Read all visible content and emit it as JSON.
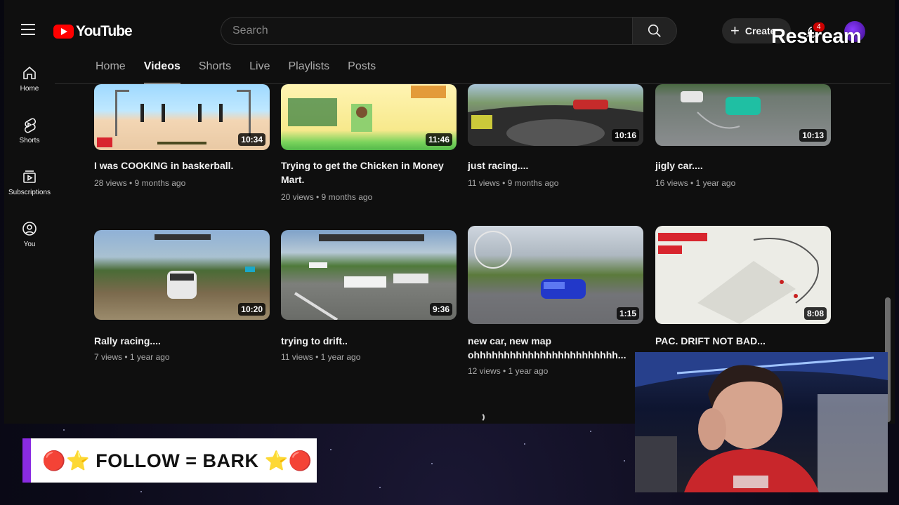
{
  "header": {
    "logo_text": "YouTube",
    "search_placeholder": "Search",
    "create_label": "Create",
    "notification_count": "4"
  },
  "overlay": {
    "restream_label": "Restream",
    "follow_text": "🔴⭐ FOLLOW = BARK ⭐🔴"
  },
  "sidebar": {
    "items": [
      {
        "label": "Home",
        "icon": "home-icon"
      },
      {
        "label": "Shorts",
        "icon": "shorts-icon"
      },
      {
        "label": "Subscriptions",
        "icon": "subscriptions-icon"
      },
      {
        "label": "You",
        "icon": "you-icon"
      }
    ]
  },
  "tabs": [
    {
      "label": "Home",
      "active": false
    },
    {
      "label": "Videos",
      "active": true
    },
    {
      "label": "Shorts",
      "active": false
    },
    {
      "label": "Live",
      "active": false
    },
    {
      "label": "Playlists",
      "active": false
    },
    {
      "label": "Posts",
      "active": false
    }
  ],
  "videos": [
    {
      "title": "I was COOKING in baskerball.",
      "meta": "28 views • 9 months ago",
      "duration": "10:34"
    },
    {
      "title": "Trying to get the Chicken in Money Mart.",
      "meta": "20 views • 9 months ago",
      "duration": "11:46"
    },
    {
      "title": "just racing....",
      "meta": "11 views • 9 months ago",
      "duration": "10:16"
    },
    {
      "title": "jigly car....",
      "meta": "16 views • 1 year ago",
      "duration": "10:13"
    },
    {
      "title": "Rally racing....",
      "meta": "7 views • 1 year ago",
      "duration": "10:20"
    },
    {
      "title": "trying to drift..",
      "meta": "11 views • 1 year ago",
      "duration": "9:36"
    },
    {
      "title": "new car, new map ohhhhhhhhhhhhhhhhhhhhhhhh...",
      "meta": "12 views • 1 year ago",
      "duration": "1:15"
    },
    {
      "title": "PAC. DRIFT NOT BAD...",
      "meta": "",
      "duration": "8:08"
    }
  ]
}
